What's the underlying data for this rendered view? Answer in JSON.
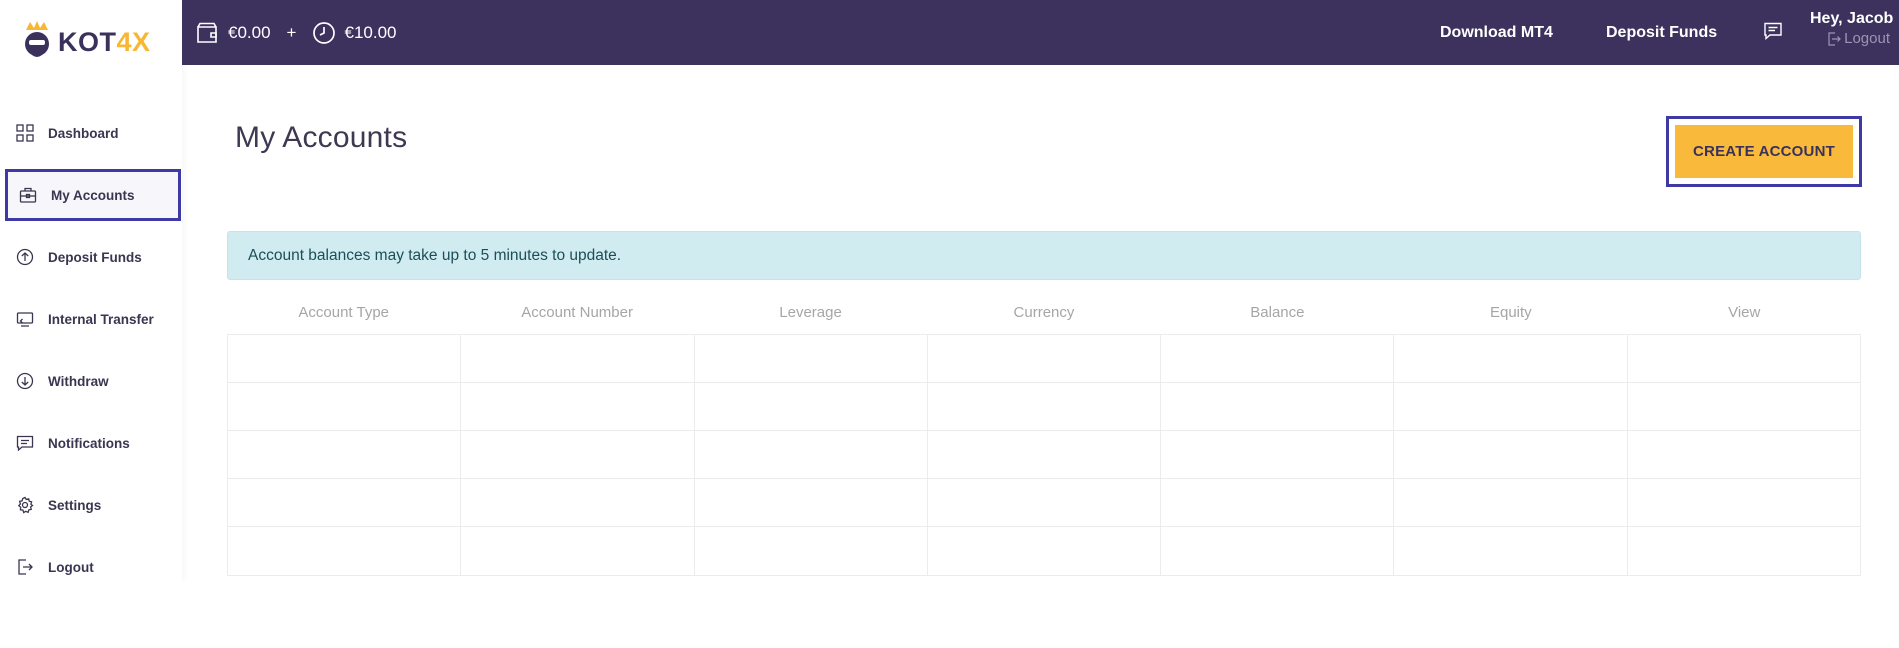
{
  "brand": {
    "name_part1": "KOT",
    "name_part2": "4X",
    "accent_color": "#f7b733",
    "primary_color": "#3d325e"
  },
  "topbar": {
    "balance": "€0.00",
    "plus": "+",
    "bonus": "€10.00",
    "download_mt4": "Download MT4",
    "deposit_funds": "Deposit Funds",
    "greeting": "Hey, Jacob",
    "logout": "Logout"
  },
  "sidebar": {
    "items": [
      {
        "label": "Dashboard",
        "icon": "grid-icon"
      },
      {
        "label": "My Accounts",
        "icon": "briefcase-icon",
        "active": true
      },
      {
        "label": "Deposit Funds",
        "icon": "arrow-up-circle-icon"
      },
      {
        "label": "Internal Transfer",
        "icon": "transfer-icon"
      },
      {
        "label": "Withdraw",
        "icon": "arrow-down-circle-icon"
      },
      {
        "label": "Notifications",
        "icon": "chat-icon"
      },
      {
        "label": "Settings",
        "icon": "gear-icon"
      },
      {
        "label": "Logout",
        "icon": "logout-icon"
      }
    ]
  },
  "main": {
    "title": "My Accounts",
    "create_button": "CREATE ACCOUNT",
    "alert": "Account balances may take up to 5 minutes to update.",
    "table": {
      "columns": [
        "Account Type",
        "Account Number",
        "Leverage",
        "Currency",
        "Balance",
        "Equity",
        "View"
      ]
    }
  }
}
